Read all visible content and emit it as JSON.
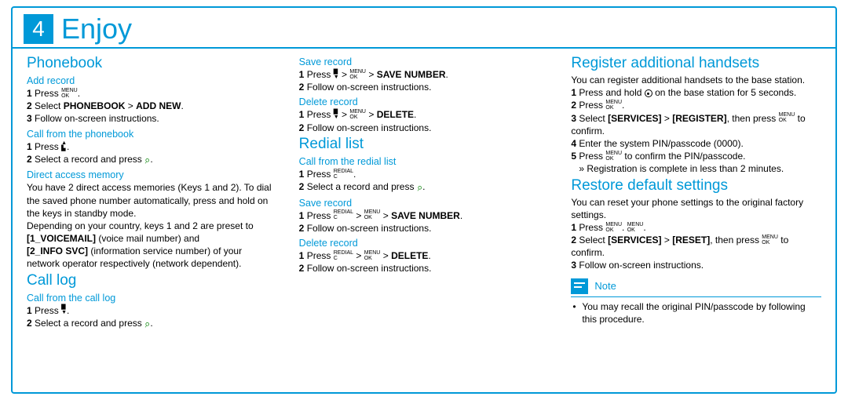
{
  "header": {
    "num": "4",
    "title": "Enjoy"
  },
  "c1": {
    "phonebook": "Phonebook",
    "add_record": "Add record",
    "ar1a": "1",
    "ar1b": "Press",
    "ar2a": "2",
    "ar2b": "Select",
    "ar2c": "PHONEBOOK",
    "ar2d": ">",
    "ar2e": "ADD NEW",
    "ar3a": "3",
    "ar3b": "Follow on-screen instructions.",
    "cfp": "Call from the phonebook",
    "cf1a": "1",
    "cf1b": "Press",
    "cf2a": "2",
    "cf2b": "Select a record and press",
    "dam": "Direct access memory",
    "dam_p1": "You have 2 direct access memories (Keys 1 and 2). To dial the saved phone number automatically, press and hold on the keys in standby mode.",
    "dam_p2a": "Depending on your country, keys 1 and 2 are preset to ",
    "dam_p2b": "[1_VOICEMAIL]",
    "dam_p2c": " (voice mail number) and ",
    "dam_p2d": "[2_INFO SVC]",
    "dam_p2e": " (information service number) of your network operator respectively (network dependent).",
    "calllog": "Call log",
    "cfl": "Call from the call log",
    "cl1a": "1",
    "cl1b": "Press",
    "cl2a": "2",
    "cl2b": "Select a record and press"
  },
  "c2": {
    "save_record": "Save record",
    "sr1a": "1",
    "sr1b": "Press",
    "sr1c": ">",
    "sr1d": "SAVE NUMBER",
    "sr2a": "2",
    "sr2b": "Follow on-screen instructions.",
    "del_record": "Delete record",
    "dr1a": "1",
    "dr1b": "Press",
    "dr1c": ">",
    "dr1d": "DELETE",
    "dr2a": "2",
    "dr2b": "Follow on-screen instructions.",
    "redial": "Redial list",
    "cfr": "Call from the redial list",
    "rl1a": "1",
    "rl1b": "Press",
    "rl2a": "2",
    "rl2b": "Select a record and press",
    "sr2_1a": "1",
    "sr2_1b": "Press",
    "sr2_1c": ">",
    "sr2_1d": "SAVE NUMBER",
    "sr2_2a": "2",
    "sr2_2b": "Follow on-screen instructions.",
    "dr2_1a": "1",
    "dr2_1b": "Press",
    "dr2_1c": ">",
    "dr2_1d": "DELETE",
    "dr2_2a": "2",
    "dr2_2b": "Follow on-screen instructions."
  },
  "c3": {
    "rah": "Register additional handsets",
    "rah_p": "You can register additional handsets to the base station.",
    "r1a": "1",
    "r1b": "Press and hold",
    "r1c": "on the base station for 5 seconds.",
    "r2a": "2",
    "r2b": "Press",
    "r3a": "3",
    "r3b": "Select",
    "r3c": "[SERVICES]",
    "r3d": ">",
    "r3e": "[REGISTER]",
    "r3f": ", then press",
    "r3g": "to confirm.",
    "r4a": "4",
    "r4b": "Enter the system PIN/passcode (0000).",
    "r5a": "5",
    "r5b": "Press",
    "r5c": "to confirm the PIN/passcode.",
    "r5d": "»",
    "r5e": "Registration is complete in less than 2 minutes.",
    "rds": "Restore default settings",
    "rds_p": "You can reset your phone settings to the original factory settings.",
    "s1a": "1",
    "s1b": "Press",
    "s2a": "2",
    "s2b": "Select",
    "s2c": "[SERVICES]",
    "s2d": ">",
    "s2e": "[RESET]",
    "s2f": ", then press",
    "s2g": "to confirm.",
    "s3a": "3",
    "s3b": "Follow on-screen instructions.",
    "note_label": "Note",
    "note_body": "You may recall the original PIN/passcode by following this procedure."
  },
  "iconlabels": {
    "menu": "MENU",
    "ok": "OK",
    "redial": "REDIAL",
    "c": "C"
  }
}
